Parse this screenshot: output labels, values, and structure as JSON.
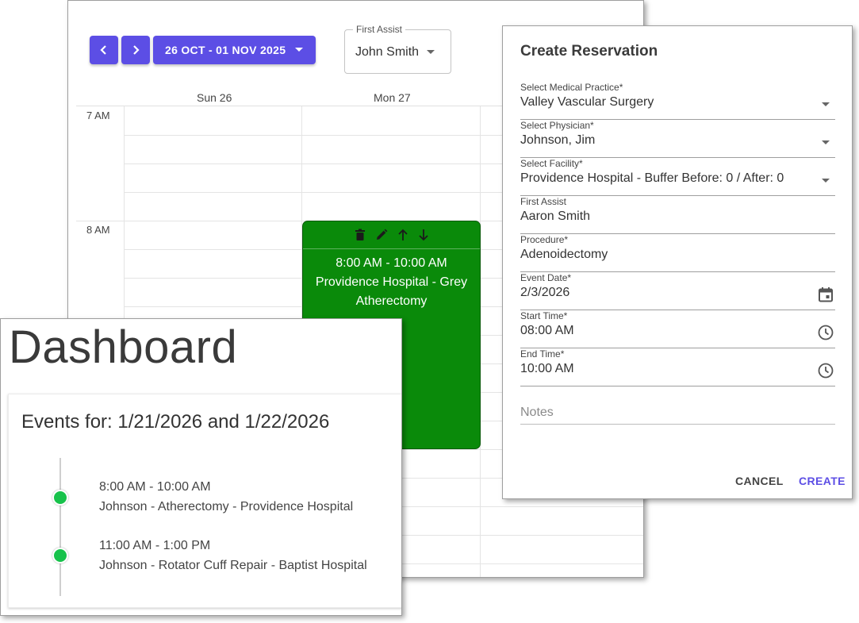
{
  "calendar": {
    "date_range_label": "26 OCT - 01 NOV 2025",
    "first_assist_filter": {
      "label": "First Assist",
      "value": "John Smith"
    },
    "days": [
      "Sun 26",
      "Mon 27"
    ],
    "hours": [
      "7 AM",
      "8 AM"
    ],
    "event": {
      "time": "8:00 AM - 10:00 AM",
      "location": "Providence Hospital - Grey",
      "procedure": "Atherectomy",
      "color": "#0a8a0a"
    },
    "accent_color": "#5c4ee5"
  },
  "dashboard": {
    "title": "Dashboard",
    "events_heading": "Events for: 1/21/2026 and 1/22/2026",
    "events": [
      {
        "time": "8:00 AM - 10:00 AM",
        "description": "Johnson - Atherectomy - Providence Hospital"
      },
      {
        "time": "11:00 AM - 1:00 PM",
        "description": "Johnson - Rotator Cuff Repair - Baptist Hospital"
      }
    ],
    "dot_color": "#17c24b"
  },
  "dialog": {
    "title": "Create Reservation",
    "fields": {
      "medical_practice": {
        "label": "Select Medical Practice*",
        "value": "Valley Vascular Surgery"
      },
      "physician": {
        "label": "Select Physician*",
        "value": "Johnson, Jim"
      },
      "facility": {
        "label": "Select Facility*",
        "value": "Providence Hospital - Buffer Before: 0 / After: 0"
      },
      "first_assist": {
        "label": "First Assist",
        "value": "Aaron Smith"
      },
      "procedure": {
        "label": "Procedure*",
        "value": "Adenoidectomy"
      },
      "event_date": {
        "label": "Event Date*",
        "value": "2/3/2026"
      },
      "start_time": {
        "label": "Start Time*",
        "value": "08:00 AM"
      },
      "end_time": {
        "label": "End Time*",
        "value": "10:00 AM"
      }
    },
    "notes_placeholder": "Notes",
    "cancel_label": "CANCEL",
    "create_label": "CREATE"
  },
  "icons": [
    "chevron-left-icon",
    "chevron-right-icon",
    "caret-down-icon",
    "trash-icon",
    "pencil-icon",
    "arrow-up-icon",
    "arrow-down-icon",
    "calendar-icon",
    "clock-icon"
  ]
}
